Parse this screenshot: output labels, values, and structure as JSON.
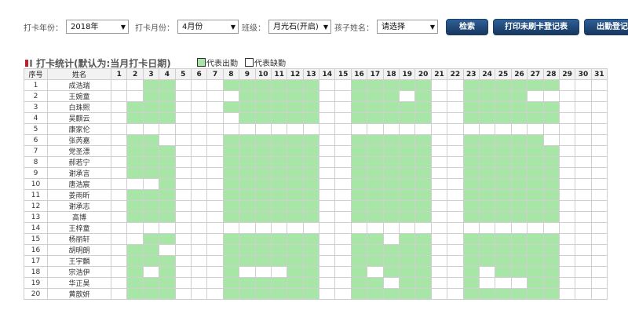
{
  "filters": {
    "year_label": "打卡年份：",
    "year_value": "2018年",
    "month_label": "打卡月份：",
    "month_value": "4月份",
    "class_label": "班级：",
    "class_value": "月光石(开启)",
    "child_label": "孩子姓名：",
    "child_value": "请选择"
  },
  "buttons": {
    "search": "检索",
    "print_unmarked": "打印未刷卡登记表",
    "attendance_form": "出勤登记表"
  },
  "section": {
    "title": "打卡统计(默认为:当月打卡日期)",
    "legend_present": "代表出勤",
    "legend_absent": "代表缺勤"
  },
  "colors": {
    "present": "#a8e6a8",
    "absent": "#ffffff",
    "button": "#1f4a7c"
  },
  "table": {
    "header_index": "序号",
    "header_name": "姓名",
    "days": [
      1,
      2,
      3,
      4,
      5,
      6,
      7,
      8,
      9,
      10,
      11,
      12,
      13,
      14,
      15,
      16,
      17,
      18,
      19,
      20,
      21,
      22,
      23,
      24,
      25,
      26,
      27,
      28,
      29,
      30,
      31
    ],
    "rows": [
      {
        "index": "1",
        "name": "成浩瑞",
        "present": [
          3,
          4,
          8,
          9,
          10,
          11,
          12,
          13,
          16,
          17,
          18,
          19,
          20,
          23,
          24,
          25,
          26,
          27,
          28
        ]
      },
      {
        "index": "2",
        "name": "王婉童",
        "present": [
          3,
          4,
          9,
          10,
          11,
          12,
          13,
          16,
          17,
          18,
          20,
          23,
          24,
          25,
          26
        ]
      },
      {
        "index": "3",
        "name": "白珠熙",
        "present": [
          2,
          3,
          4,
          8,
          9,
          10,
          11,
          12,
          13,
          16,
          17,
          18,
          19,
          20,
          23,
          24,
          25,
          26,
          27,
          28
        ]
      },
      {
        "index": "4",
        "name": "吴麒云",
        "present": [
          2,
          3,
          4,
          9,
          10,
          11,
          12,
          13,
          16,
          17,
          18,
          19,
          20,
          23,
          24,
          25,
          26,
          27,
          28
        ]
      },
      {
        "index": "5",
        "name": "康家伦",
        "present": []
      },
      {
        "index": "6",
        "name": "张芮嘉",
        "present": [
          2,
          3,
          8,
          9,
          10,
          11,
          12,
          13,
          16,
          17,
          18,
          19,
          20,
          23,
          24,
          25,
          26,
          27
        ]
      },
      {
        "index": "7",
        "name": "党圣漂",
        "present": [
          2,
          3,
          4,
          8,
          9,
          10,
          11,
          12,
          13,
          16,
          17,
          18,
          19,
          20,
          23,
          24,
          25,
          26,
          27,
          28
        ]
      },
      {
        "index": "8",
        "name": "郝若宁",
        "present": [
          2,
          3,
          4,
          8,
          9,
          10,
          11,
          12,
          13,
          16,
          17,
          18,
          19,
          20,
          23,
          24,
          25,
          26,
          27,
          28
        ]
      },
      {
        "index": "9",
        "name": "谢承言",
        "present": [
          2,
          3,
          4,
          8,
          9,
          10,
          11,
          12,
          13,
          16,
          17,
          18,
          19,
          20,
          23,
          24,
          25,
          26,
          27,
          28
        ]
      },
      {
        "index": "10",
        "name": "唐浩宸",
        "present": [
          4,
          8,
          9,
          10,
          11,
          12,
          13,
          16,
          17,
          18,
          19,
          20,
          23,
          24,
          25,
          26,
          27,
          28
        ]
      },
      {
        "index": "11",
        "name": "姜雨昕",
        "present": [
          2,
          3,
          4,
          8,
          9,
          10,
          11,
          12,
          13,
          16,
          17,
          18,
          19,
          20,
          23,
          24,
          25,
          26,
          27,
          28
        ]
      },
      {
        "index": "12",
        "name": "谢承志",
        "present": [
          2,
          3,
          4,
          8,
          9,
          10,
          11,
          12,
          13,
          16,
          17,
          18,
          19,
          20,
          23,
          24,
          25,
          26,
          27,
          28
        ]
      },
      {
        "index": "13",
        "name": "高博",
        "present": [
          2,
          3,
          4,
          8,
          9,
          10,
          11,
          12,
          13,
          16,
          17,
          18,
          19,
          20,
          23,
          24,
          25,
          26,
          27,
          28
        ]
      },
      {
        "index": "14",
        "name": "王梓童",
        "present": []
      },
      {
        "index": "15",
        "name": "杨丽轩",
        "present": [
          3,
          4,
          8,
          9,
          10,
          11,
          12,
          13,
          16,
          17,
          19,
          20,
          23,
          24,
          25,
          26,
          27,
          28
        ]
      },
      {
        "index": "16",
        "name": "胡明朗",
        "present": [
          2,
          3,
          8,
          9,
          10,
          11,
          12,
          13,
          16,
          17,
          18,
          19,
          20,
          23,
          24,
          25,
          26,
          27,
          28
        ]
      },
      {
        "index": "17",
        "name": "王宇麟",
        "present": [
          2,
          3,
          4,
          8,
          9,
          10,
          11,
          12,
          13,
          16,
          17,
          18,
          19,
          20,
          23,
          24,
          25,
          26,
          27,
          28
        ]
      },
      {
        "index": "18",
        "name": "宗浩伊",
        "present": [
          2,
          4,
          8,
          12,
          13,
          16,
          18,
          19,
          20,
          23,
          25,
          26,
          27,
          28
        ]
      },
      {
        "index": "19",
        "name": "华正昊",
        "present": [
          2,
          3,
          4,
          8,
          9,
          10,
          11,
          12,
          13,
          16,
          17,
          19,
          20,
          23,
          27,
          28
        ]
      },
      {
        "index": "20",
        "name": "黄歆妍",
        "present": [
          2,
          3,
          4,
          8,
          9,
          10,
          11,
          12,
          13,
          16,
          17,
          18,
          19,
          20,
          23,
          24,
          25,
          26,
          27,
          28
        ]
      }
    ]
  }
}
